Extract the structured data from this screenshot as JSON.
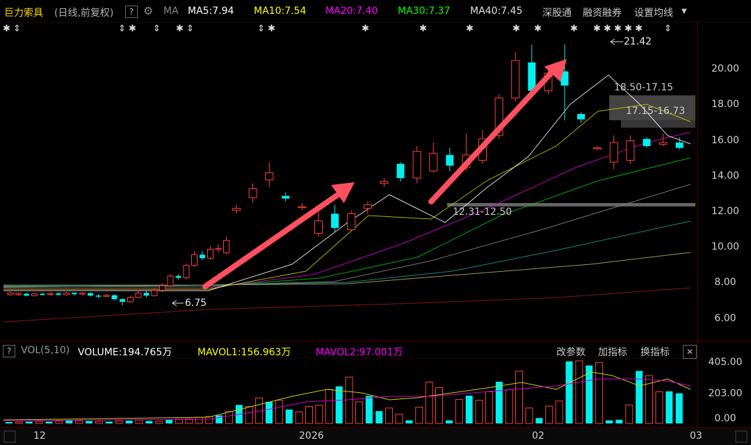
{
  "header": {
    "stock_name": "巨力索具",
    "period": "(日线,前复权)",
    "help": "?",
    "ma_label": "MA",
    "ma5": "MA5:7.94",
    "ma10": "MA10:7.54",
    "ma20": "MA20:7.40",
    "ma30": "MA30:7.37",
    "ma40": "MA40:7.45",
    "link1": "深股通",
    "link2": "融资融券",
    "link3": "设置均线",
    "colors": {
      "ma5": "#ffffff",
      "ma10": "#ffff00",
      "ma20": "#ff00ff",
      "ma30": "#00ff00",
      "ma40": "#e0e0e0"
    }
  },
  "price_axis": [
    "20.00",
    "18.00",
    "16.00",
    "14.00",
    "12.00",
    "10.00",
    "8.00",
    "6.00"
  ],
  "annotations": {
    "high": "21.42",
    "low": "6.75",
    "zone1": "18.50-17.15",
    "zone2": "17.15-16.73",
    "zone3": "12.31-12.50"
  },
  "volume_panel": {
    "help": "?",
    "vol": "VOL(5,10)",
    "volume": "VOLUME:194.765万",
    "mavol1": "MAVOL1:156.963万",
    "mavol2": "MAVOL2:97.001万",
    "btn_params": "改参数",
    "btn_add": "加指标",
    "btn_switch": "换指标",
    "close": "✕",
    "axis": [
      "405.00",
      "203.00",
      "0.00"
    ]
  },
  "x_axis": [
    "12",
    "2026",
    "02",
    "03"
  ],
  "chart_data": {
    "type": "candlestick",
    "ylim": [
      5.5,
      22
    ],
    "volume_ylim": [
      0,
      420
    ],
    "candles": [
      [
        7.35,
        7.45,
        7.3,
        7.5
      ],
      [
        7.35,
        7.42,
        7.28,
        7.48
      ],
      [
        7.4,
        7.3,
        7.25,
        7.45
      ],
      [
        7.3,
        7.4,
        7.25,
        7.45
      ],
      [
        7.4,
        7.36,
        7.3,
        7.48
      ],
      [
        7.36,
        7.42,
        7.3,
        7.48
      ],
      [
        7.42,
        7.35,
        7.3,
        7.48
      ],
      [
        7.35,
        7.45,
        7.3,
        7.5
      ],
      [
        7.45,
        7.38,
        7.3,
        7.5
      ],
      [
        7.38,
        7.44,
        7.32,
        7.5
      ],
      [
        7.44,
        7.3,
        7.25,
        7.48
      ],
      [
        7.3,
        7.25,
        7.18,
        7.38
      ],
      [
        7.25,
        7.32,
        7.2,
        7.4
      ],
      [
        7.32,
        7.1,
        7.05,
        7.36
      ],
      [
        7.1,
        6.95,
        6.75,
        7.15
      ],
      [
        6.95,
        7.2,
        6.9,
        7.28
      ],
      [
        7.2,
        7.45,
        7.15,
        7.6
      ],
      [
        7.45,
        7.3,
        7.2,
        7.55
      ],
      [
        7.3,
        7.6,
        7.25,
        7.7
      ],
      [
        7.6,
        7.85,
        7.5,
        8.0
      ],
      [
        7.85,
        8.4,
        7.8,
        8.5
      ],
      [
        8.4,
        8.3,
        8.2,
        8.5
      ],
      [
        8.3,
        9.0,
        8.2,
        9.1
      ],
      [
        9.0,
        9.6,
        8.9,
        9.8
      ],
      [
        9.6,
        9.4,
        9.3,
        9.8
      ],
      [
        9.4,
        9.9,
        9.3,
        10.1
      ],
      [
        9.9,
        9.95,
        9.7,
        10.2
      ],
      [
        9.7,
        10.4,
        9.6,
        10.6
      ],
      [
        12.1,
        12.2,
        11.9,
        12.4
      ],
      [
        12.8,
        13.3,
        12.5,
        13.6
      ],
      [
        13.8,
        14.2,
        13.4,
        14.8
      ],
      [
        12.9,
        12.75,
        12.6,
        13.1
      ],
      [
        12.3,
        12.3,
        12.1,
        12.5
      ],
      [
        10.8,
        11.5,
        10.6,
        12.0
      ],
      [
        11.9,
        11.1,
        10.9,
        12.4
      ],
      [
        11.0,
        11.9,
        10.9,
        12.1
      ],
      [
        12.2,
        12.4,
        11.9,
        12.6
      ],
      [
        13.6,
        13.7,
        13.4,
        13.9
      ],
      [
        14.7,
        13.9,
        13.7,
        14.8
      ],
      [
        13.9,
        15.4,
        13.6,
        15.7
      ],
      [
        14.3,
        15.3,
        14.2,
        15.9
      ],
      [
        15.2,
        14.6,
        14.3,
        15.6
      ],
      [
        14.5,
        15.2,
        14.3,
        16.4
      ],
      [
        14.9,
        16.1,
        14.7,
        16.6
      ],
      [
        16.3,
        18.4,
        16.1,
        18.6
      ],
      [
        18.4,
        20.5,
        18.2,
        21.0
      ],
      [
        20.4,
        18.8,
        18.5,
        21.4
      ],
      [
        18.8,
        19.8,
        18.6,
        20.1
      ],
      [
        19.9,
        19.1,
        17.15,
        21.42
      ],
      [
        17.5,
        17.2,
        17.0,
        17.6
      ],
      [
        15.6,
        15.6,
        15.5,
        15.7
      ],
      [
        14.8,
        15.9,
        14.4,
        16.3
      ],
      [
        14.9,
        16.0,
        14.7,
        16.3
      ],
      [
        16.1,
        15.7,
        15.6,
        16.2
      ],
      [
        15.8,
        15.9,
        15.7,
        16.4
      ],
      [
        15.9,
        15.6,
        15.5,
        16.2
      ]
    ],
    "volumes": [
      8,
      10,
      12,
      14,
      12,
      16,
      20,
      18,
      16,
      14,
      12,
      16,
      18,
      22,
      16,
      14,
      24,
      28,
      30,
      40,
      45,
      52,
      78,
      120,
      110,
      165,
      140,
      150,
      90,
      75,
      110,
      118,
      220,
      240,
      300,
      140,
      178,
      80,
      100,
      60,
      20,
      105,
      268,
      232,
      20,
      155,
      180,
      150,
      205,
      270,
      218,
      338,
      100,
      35,
      112,
      145,
      402,
      405,
      375,
      395,
      20,
      24,
      120,
      340,
      310,
      205,
      208,
      195
    ],
    "volume_up_flags": [
      0,
      1,
      0,
      1,
      0,
      1,
      0,
      1,
      0,
      1,
      0,
      1,
      0,
      1,
      0,
      1,
      0,
      1,
      1,
      1,
      1,
      0,
      1,
      0,
      1,
      1,
      0,
      1,
      0,
      1,
      1,
      1,
      1,
      0,
      1,
      1,
      0,
      0,
      1,
      1,
      0,
      1,
      1,
      1,
      0,
      1,
      0,
      1,
      1,
      0,
      1,
      1,
      1,
      0,
      1,
      1,
      0,
      1,
      0,
      1,
      0,
      0,
      1,
      0,
      1,
      1,
      0,
      0
    ]
  }
}
